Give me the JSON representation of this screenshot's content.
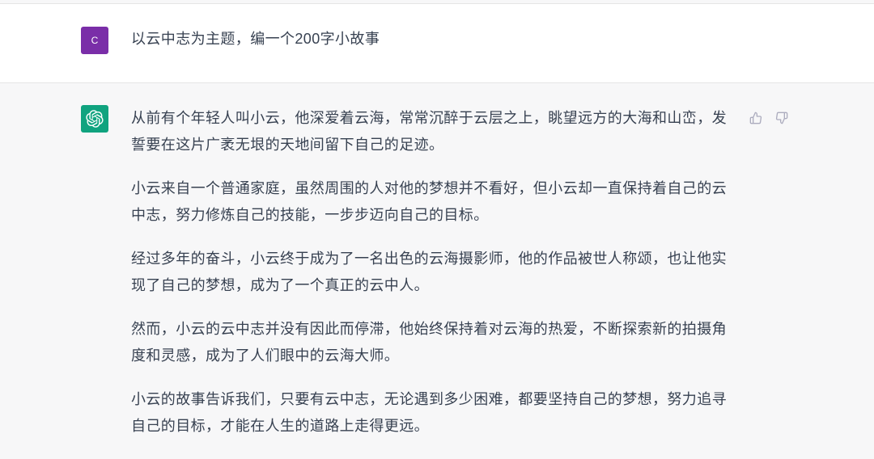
{
  "conversation": {
    "user_message": {
      "avatar_letter": "C",
      "text": "以云中志为主题，编一个200字小故事"
    },
    "assistant_message": {
      "avatar_icon": "openai-logo-icon",
      "paragraphs": [
        {
          "lines": [
            "从前有个年轻人叫小云，他深爱着云海，常常沉醉于云层之上，眺望远方的大海和山峦，发",
            "誓要在这片广袤无垠的天地间留下自己的足迹。"
          ]
        },
        {
          "lines": [
            "小云来自一个普通家庭，虽然周围的人对他的梦想并不看好，但小云却一直保持着自己的云",
            "中志，努力修炼自己的技能，一步步迈向自己的目标。"
          ]
        },
        {
          "lines": [
            "经过多年的奋斗，小云终于成为了一名出色的云海摄影师，他的作品被世人称颂，也让他实",
            "现了自己的梦想，成为了一个真正的云中人。"
          ]
        },
        {
          "lines": [
            "然而，小云的云中志并没有因此而停滞，他始终保持着对云海的热爱，不断探索新的拍摄角",
            "度和灵感，成为了人们眼中的云海大师。"
          ]
        },
        {
          "lines": [
            "小云的故事告诉我们，只要有云中志，无论遇到多少困难，都要坚持自己的梦想，努力追寻",
            "自己的目标，才能在人生的道路上走得更远。"
          ]
        }
      ],
      "actions": {
        "like_icon": "thumbs-up-icon",
        "dislike_icon": "thumbs-down-icon"
      }
    }
  },
  "colors": {
    "user_avatar": "#7a2ea8",
    "assistant_avatar": "#10a37f",
    "assistant_background": "#f7f7f8",
    "text": "#374151",
    "icon": "#acacbe"
  }
}
